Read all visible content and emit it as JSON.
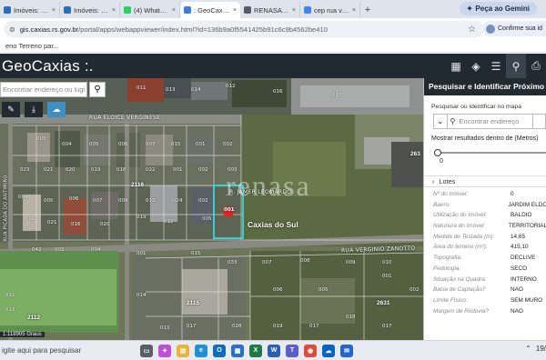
{
  "browser": {
    "tabs": [
      {
        "label": "Imóveis: Consult",
        "color": "#2a6fb8",
        "active": false
      },
      {
        "label": "Imóveis: Consult",
        "color": "#2a6fb8",
        "active": false
      },
      {
        "label": "(4) WhatsApp B",
        "color": "#25d366",
        "active": false
      },
      {
        "label": ": GeoCaxias :.",
        "color": "#3b7dd8",
        "active": true
      },
      {
        "label": "RENASA NEGO",
        "color": "#555b66",
        "active": false
      },
      {
        "label": "cep rua vergíni",
        "color": "#4285f4",
        "active": false
      }
    ],
    "new_tab": "+",
    "gemini_label": "Peça ao Gemini",
    "url_host": "gis.caxias.rs.gov.br",
    "url_path": "/portal/apps/webappviewer/index.html?id=136b9a0f5541425b91c6c9b4562be410",
    "confirm_label": "Confirme sua id",
    "bookmark": "eno Terreno par..."
  },
  "app": {
    "title": "GeoCaxias :."
  },
  "map": {
    "search_placeholder": "Encontrar endereço ou lugi",
    "streets": {
      "top": "RUA ELOICE VERGINESE",
      "mid": "RUA VERGINIO ZANOTTO",
      "lot": "R. JAMER LEOMARDO",
      "left": "RUA PICADA DO ANTIMIRO"
    },
    "blocks": [
      "2116",
      "2115",
      "2112",
      "2631",
      "263"
    ],
    "city": "Caxias do Sul",
    "watermark": "renasa",
    "scale": "1:118905 Graus",
    "lots": [
      "011",
      "013",
      "014",
      "012",
      "016",
      "017",
      "003",
      "004",
      "005",
      "006",
      "007",
      "015",
      "001",
      "002",
      "023",
      "021",
      "020",
      "019",
      "018",
      "022",
      "001",
      "002",
      "003",
      "004",
      "005",
      "006",
      "007",
      "008",
      "012",
      "024",
      "002",
      "001",
      "021",
      "016",
      "020",
      "019",
      "012",
      "005",
      "042",
      "002",
      "004",
      "001",
      "015",
      "033",
      "007",
      "008",
      "009",
      "010",
      "011",
      "012",
      "014",
      "013",
      "017",
      "028",
      "019",
      "017",
      "018",
      "017",
      "002",
      "001",
      "005",
      "006"
    ],
    "highlight_lot": "001"
  },
  "panel": {
    "title": "Pesquisar e Identificar Próximo",
    "search_label": "Pesquisar ou identificar no mapa",
    "input_placeholder": "Encontrar endereço",
    "distance_label": "Mostrar resultados dentro de (Metros)",
    "slider_value": "0",
    "slider_fraction": 0,
    "back_label": "Lotes",
    "attributes": [
      {
        "k": "Nº do Imóvel:",
        "v": "0"
      },
      {
        "k": "Bairro:",
        "v": "JARDIM ELDO"
      },
      {
        "k": "Utilização do Imóvel:",
        "v": "BALDIO"
      },
      {
        "k": "Natureza do Imóvel:",
        "v": "TERRITORIAL"
      },
      {
        "k": "Medida de Testada (m):",
        "v": "14,65"
      },
      {
        "k": "Área do terreno (m²):",
        "v": "415,10"
      },
      {
        "k": "Topografia:",
        "v": "DECLIVE"
      },
      {
        "k": "Pedologia:",
        "v": "SECO"
      },
      {
        "k": "Situação na Quadra:",
        "v": "INTERNO"
      },
      {
        "k": "Bacia de Captação?",
        "v": "NAO"
      },
      {
        "k": "Limite Físico:",
        "v": "SEM MURO"
      },
      {
        "k": "Margem de Rodovia?",
        "v": "NAO"
      }
    ]
  },
  "taskbar": {
    "search_text": "igite aqui para pesquisar",
    "apps": [
      {
        "name": "task-view",
        "color": "#5a5f66",
        "glyph": "▭"
      },
      {
        "name": "copilot",
        "color": "#c04fd8",
        "glyph": "✦"
      },
      {
        "name": "file-explorer",
        "color": "#e8b53a",
        "glyph": "▤"
      },
      {
        "name": "edge",
        "color": "#1f8fd6",
        "glyph": "e"
      },
      {
        "name": "outlook",
        "color": "#0f6cbd",
        "glyph": "O"
      },
      {
        "name": "store",
        "color": "#2b6fc9",
        "glyph": "▦"
      },
      {
        "name": "excel",
        "color": "#1d7a45",
        "glyph": "X"
      },
      {
        "name": "word",
        "color": "#2b5fb4",
        "glyph": "W"
      },
      {
        "name": "teams",
        "color": "#5b5fc7",
        "glyph": "T"
      },
      {
        "name": "chrome",
        "color": "#dd4b39",
        "glyph": "◉"
      },
      {
        "name": "onedrive",
        "color": "#0a64c2",
        "glyph": "☁"
      },
      {
        "name": "mail",
        "color": "#2267c7",
        "glyph": "✉"
      }
    ],
    "clock": "19/"
  }
}
